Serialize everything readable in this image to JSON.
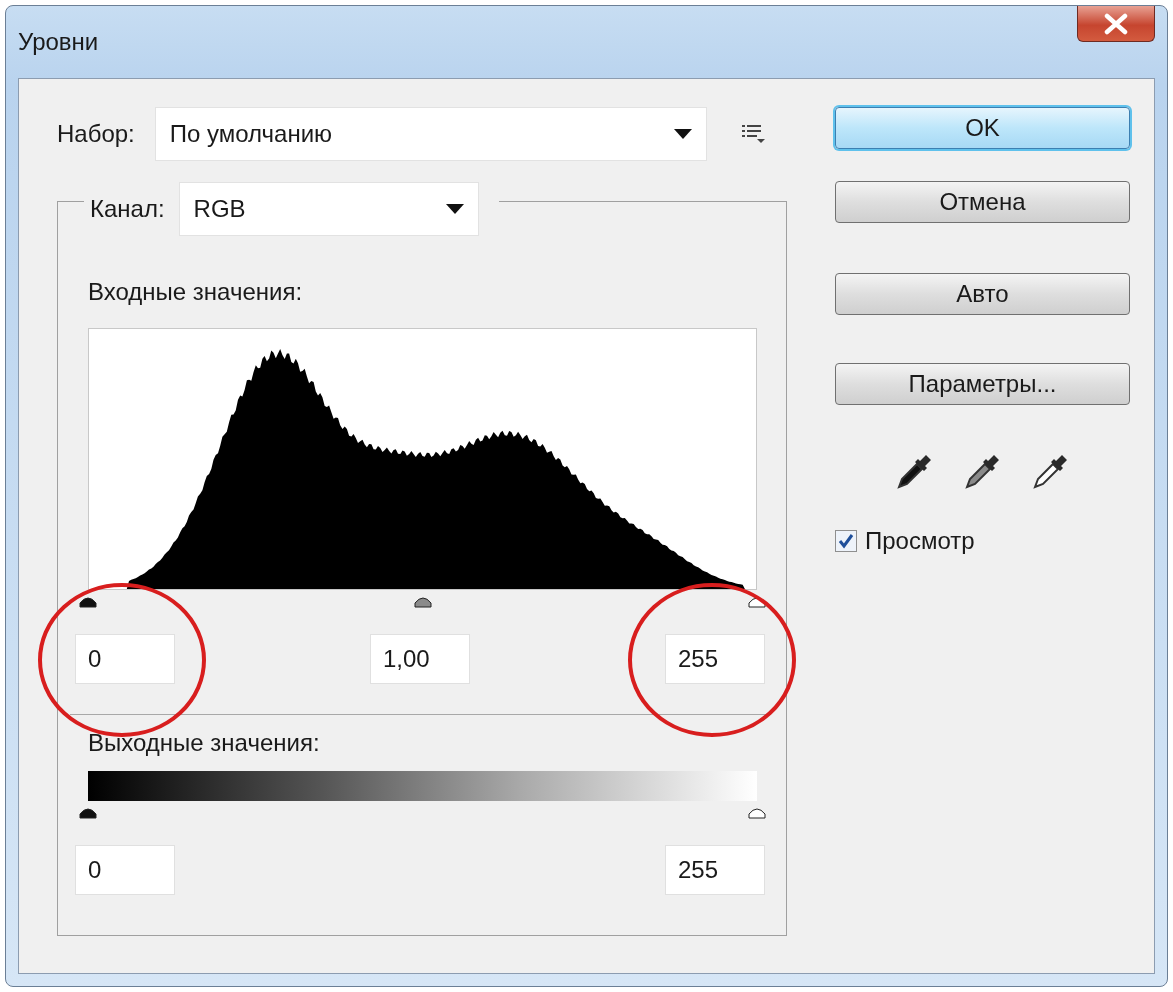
{
  "window": {
    "title": "Уровни"
  },
  "preset": {
    "label": "Набор:",
    "value": "По умолчанию"
  },
  "channel": {
    "label": "Канал:",
    "value": "RGB"
  },
  "input_levels": {
    "label": "Входные значения:",
    "sliders": [
      {
        "kind": "black"
      },
      {
        "kind": "gray"
      },
      {
        "kind": "white"
      }
    ],
    "fields": [
      {
        "value": "0",
        "circled": true
      },
      {
        "value": "1,00",
        "circled": false
      },
      {
        "value": "255",
        "circled": true
      }
    ]
  },
  "output_levels": {
    "label": "Выходные значения:",
    "sliders": [
      {
        "kind": "black"
      },
      {
        "kind": "white"
      }
    ],
    "fields": [
      {
        "value": "0",
        "circled": false
      },
      {
        "value": "255",
        "circled": false
      }
    ]
  },
  "buttons": [
    {
      "label": "OK",
      "default": true
    },
    {
      "label": "Отмена",
      "default": false
    },
    {
      "label": "Авто",
      "default": false
    },
    {
      "label": "Параметры...",
      "default": false
    }
  ],
  "eyedroppers": [
    {
      "kind": "black"
    },
    {
      "kind": "gray"
    },
    {
      "kind": "white"
    }
  ],
  "preview": {
    "label": "Просмотр",
    "checked": true
  }
}
